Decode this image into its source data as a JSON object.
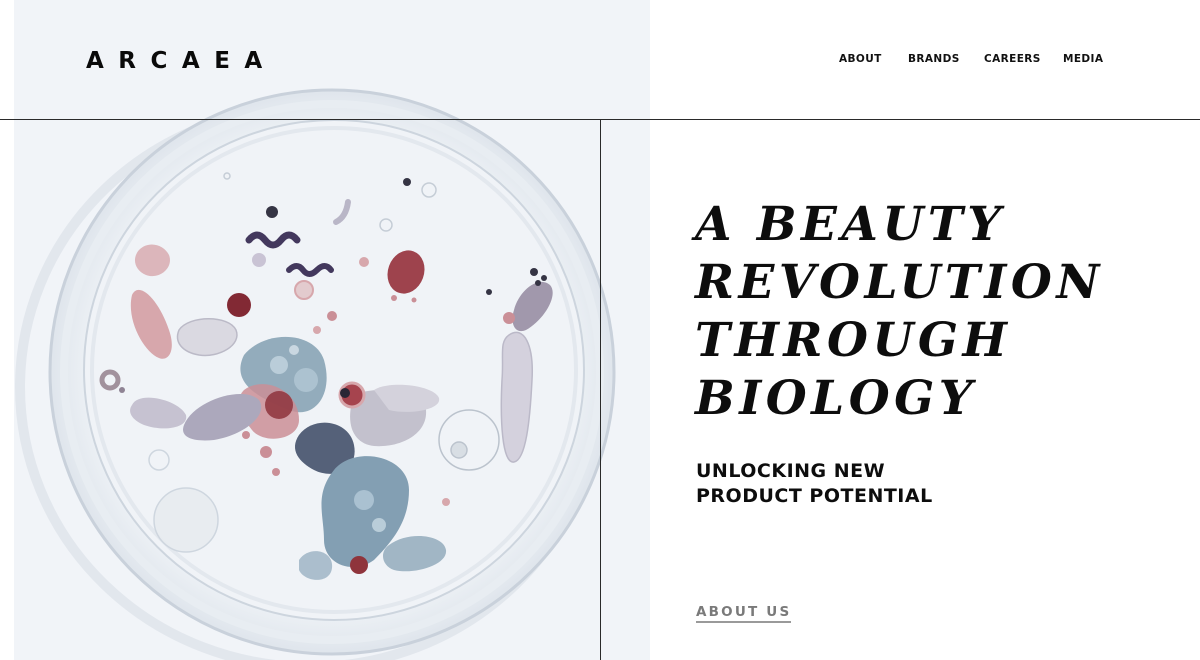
{
  "brand": {
    "logo_text": "ARCAEA"
  },
  "nav": {
    "items": [
      {
        "label": "ABOUT"
      },
      {
        "label": "BRANDS"
      },
      {
        "label": "CAREERS"
      },
      {
        "label": "MEDIA"
      }
    ]
  },
  "hero": {
    "headline_lines": [
      "A BEAUTY",
      "REVOLUTION",
      "THROUGH",
      "BIOLOGY"
    ],
    "subhead_lines": [
      "UNLOCKING NEW",
      "PRODUCT POTENTIAL"
    ],
    "cta_label": "ABOUT US"
  },
  "colors": {
    "panel_bg": "#f1f4f8",
    "text": "#0d0d0d",
    "cta": "#7a7a7a",
    "microbe_blue": "#8fa9b9",
    "microbe_pink": "#d6a3a8",
    "microbe_maroon": "#8a2a33",
    "microbe_purple": "#5a4f6e"
  }
}
